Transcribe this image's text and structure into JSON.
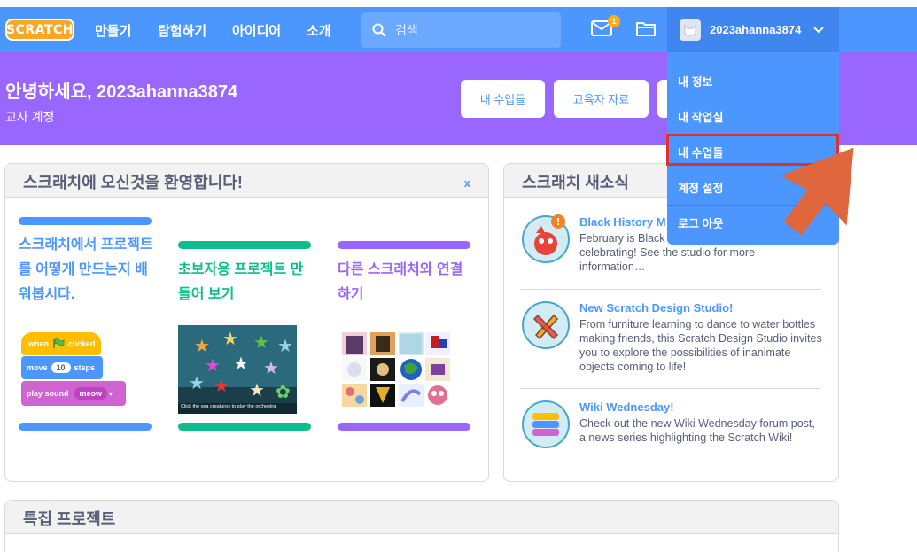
{
  "nav": {
    "logo": "SCRATCH",
    "links": [
      "만들기",
      "탐험하기",
      "아이디어",
      "소개"
    ],
    "search_placeholder": "검색",
    "message_count": "1",
    "username": "2023ahanna3874"
  },
  "banner": {
    "greeting": "안녕하세요, 2023ahanna3874",
    "role": "교사 계정",
    "buttons": [
      "내 수업들",
      "교육자 자료"
    ]
  },
  "dropdown": {
    "items": [
      "내 정보",
      "내 작업실",
      "내 수업들",
      "계정 설정",
      "로그 아웃"
    ],
    "highlighted_index": 2
  },
  "welcome": {
    "title": "스크래치에 오신것을 환영합니다!",
    "close": "x",
    "columns": [
      {
        "text": "스크래치에서 프로젝트를 어떻게 만드는지 배워봅시다.",
        "color": "#4c97ff"
      },
      {
        "text": "초보자용 프로젝트 만들어 보기",
        "color": "#0fbd8c"
      },
      {
        "text": "다른 스크래처와 연결하기",
        "color": "#9966ff"
      }
    ],
    "blocks": {
      "when": "when",
      "clicked": "clicked",
      "move": "move",
      "steps_value": "10",
      "steps": "steps",
      "play_sound": "play sound",
      "sound_name": "meow"
    },
    "thumb_caption": "Click the sea creatures to play the orchestra"
  },
  "news": {
    "title": "스크래치 새소식",
    "items": [
      {
        "title": "Black History M",
        "body": "February is Black History Month. Join us in celebrating! See the studio for more information…"
      },
      {
        "title": "New Scratch Design Studio!",
        "body": "From furniture learning to dance to water bottles making friends, this Scratch Design Studio invites you to explore the possibilities of inanimate objects coming to life!"
      },
      {
        "title": "Wiki Wednesday!",
        "body": "Check out the new Wiki Wednesday forum post, a news series highlighting the Scratch Wiki!"
      }
    ]
  },
  "featured": {
    "title": "특집 프로젝트"
  },
  "colors": {
    "nav": "#4c97ff",
    "banner": "#9966ff",
    "highlight": "#e03030",
    "arrow": "#e0663e"
  }
}
